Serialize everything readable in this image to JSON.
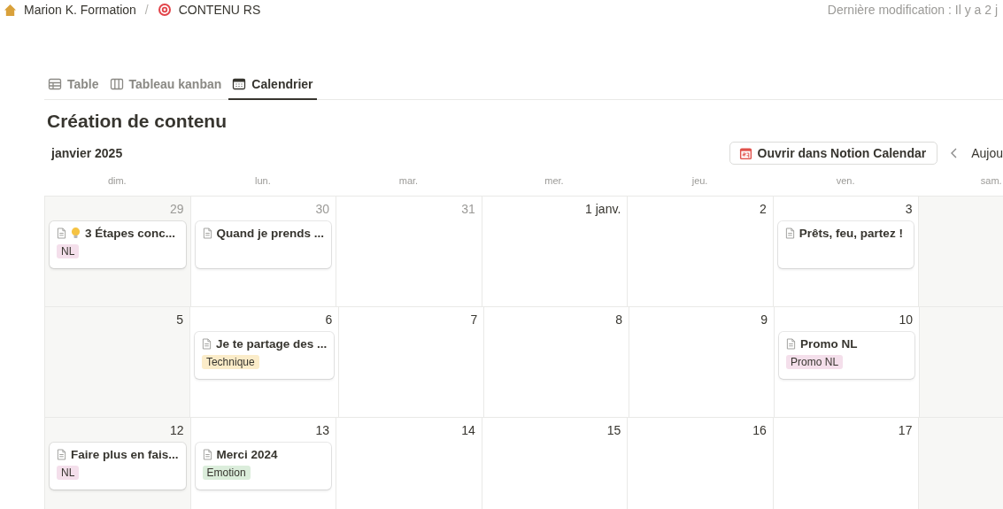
{
  "breadcrumb": [
    "Marion K. Formation",
    "CONTENU RS"
  ],
  "separator": "/",
  "last_modified": "Dernière modification : Il y a 2 j",
  "tabs": [
    {
      "label": "Table",
      "selected": false
    },
    {
      "label": "Tableau kanban",
      "selected": false
    },
    {
      "label": "Calendrier",
      "selected": true
    }
  ],
  "title": "Création de contenu",
  "month": "janvier 2025",
  "open_button": "Ouvrir dans Notion Calendar",
  "today_button": "Aujou",
  "weekdays": [
    "dim.",
    "lun.",
    "mar.",
    "mer.",
    "jeu.",
    "ven.",
    "sam."
  ],
  "weeks": [
    [
      {
        "day": "29",
        "other_month": true,
        "cards": [
          {
            "kind": "emoji",
            "title": "3 Étapes conc...",
            "tags": [
              {
                "label": "NL",
                "color": "#f4dfeb"
              }
            ]
          }
        ]
      },
      {
        "day": "30",
        "other_month": true,
        "cards": [
          {
            "kind": "plain",
            "title": "Quand je prends ..."
          }
        ]
      },
      {
        "day": "31",
        "other_month": true
      },
      {
        "day": "1 janv.",
        "other_month": false
      },
      {
        "day": "2",
        "other_month": false
      },
      {
        "day": "3",
        "other_month": false,
        "cards": [
          {
            "kind": "plain",
            "title": "Prêts, feu, partez !"
          }
        ]
      }
    ],
    [
      {
        "day": "5",
        "other_month": false
      },
      {
        "day": "6",
        "other_month": false,
        "cards": [
          {
            "kind": "plain",
            "title": "Je te partage des ...",
            "tags": [
              {
                "label": "Technique",
                "color": "#fbecc9"
              }
            ]
          }
        ]
      },
      {
        "day": "7",
        "other_month": false
      },
      {
        "day": "8",
        "other_month": false
      },
      {
        "day": "9",
        "other_month": false
      },
      {
        "day": "10",
        "other_month": false,
        "cards": [
          {
            "kind": "plain",
            "title": "Promo NL",
            "tags": [
              {
                "label": "Promo NL",
                "color": "#f4dfeb"
              }
            ]
          }
        ]
      }
    ],
    [
      {
        "day": "12",
        "other_month": false,
        "cards": [
          {
            "kind": "plain",
            "title": "Faire plus en fais...",
            "tags": [
              {
                "label": "NL",
                "color": "#f4dfeb"
              }
            ]
          }
        ]
      },
      {
        "day": "13",
        "other_month": false,
        "cards": [
          {
            "kind": "plain",
            "title": "Merci 2024",
            "tags": [
              {
                "label": "Emotion",
                "color": "#dbeddb"
              }
            ]
          }
        ]
      },
      {
        "day": "14",
        "other_month": false
      },
      {
        "day": "15",
        "other_month": false
      },
      {
        "day": "16",
        "other_month": false
      },
      {
        "day": "17",
        "other_month": false
      }
    ]
  ]
}
